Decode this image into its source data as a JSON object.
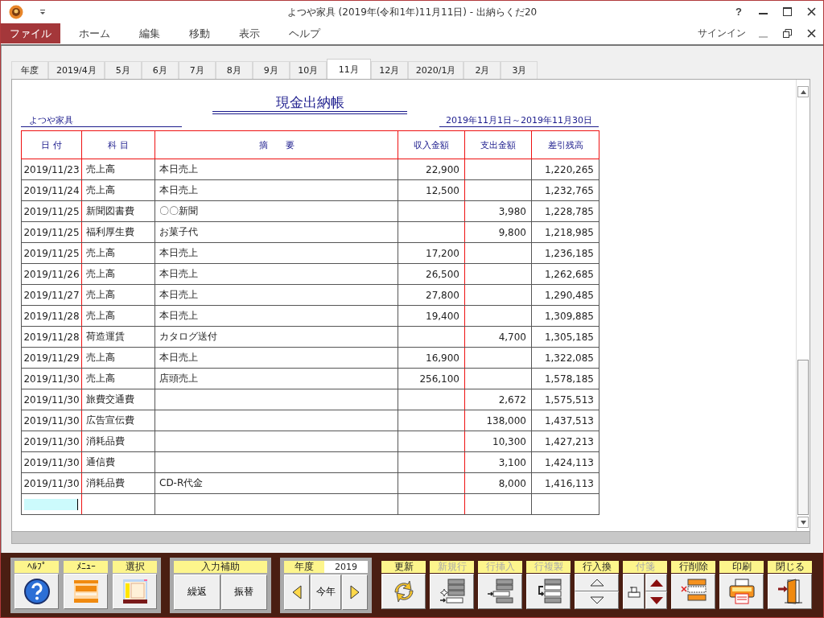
{
  "window": {
    "title": "よつや家具 (2019年(令和1年)11月11日) - 出納らくだ20",
    "help": "?"
  },
  "menu": {
    "items": [
      {
        "label": "ファイル",
        "selected": true
      },
      {
        "label": "ホーム",
        "selected": false
      },
      {
        "label": "編集",
        "selected": false
      },
      {
        "label": "移動",
        "selected": false
      },
      {
        "label": "表示",
        "selected": false
      },
      {
        "label": "ヘルプ",
        "selected": false
      }
    ],
    "signin": "サインイン"
  },
  "tabs": [
    {
      "label": "年度",
      "selected": false
    },
    {
      "label": "2019/4月",
      "selected": false
    },
    {
      "label": "5月",
      "selected": false
    },
    {
      "label": "6月",
      "selected": false
    },
    {
      "label": "7月",
      "selected": false
    },
    {
      "label": "8月",
      "selected": false
    },
    {
      "label": "9月",
      "selected": false
    },
    {
      "label": "10月",
      "selected": false
    },
    {
      "label": "11月",
      "selected": true
    },
    {
      "label": "12月",
      "selected": false
    },
    {
      "label": "2020/1月",
      "selected": false
    },
    {
      "label": "2月",
      "selected": false
    },
    {
      "label": "3月",
      "selected": false
    }
  ],
  "report": {
    "title": "現金出納帳",
    "company": "よつや家具",
    "period": "2019年11月1日～2019年11月30日",
    "columns": [
      "日 付",
      "科 目",
      "摘　　要",
      "収入金額",
      "支出金額",
      "差引残高"
    ],
    "rows": [
      {
        "date": "2019/11/23",
        "account": "売上高",
        "memo": "本日売上",
        "income": "22,900",
        "balance": "1,220,265"
      },
      {
        "date": "2019/11/24",
        "account": "売上高",
        "memo": "本日売上",
        "income": "12,500",
        "balance": "1,232,765"
      },
      {
        "date": "2019/11/25",
        "account": "新聞図書費",
        "memo": "〇〇新聞",
        "expense": "3,980",
        "balance": "1,228,785"
      },
      {
        "date": "2019/11/25",
        "account": "福利厚生費",
        "memo": "お菓子代",
        "expense": "9,800",
        "balance": "1,218,985"
      },
      {
        "date": "2019/11/25",
        "account": "売上高",
        "memo": "本日売上",
        "income": "17,200",
        "balance": "1,236,185"
      },
      {
        "date": "2019/11/26",
        "account": "売上高",
        "memo": "本日売上",
        "income": "26,500",
        "balance": "1,262,685"
      },
      {
        "date": "2019/11/27",
        "account": "売上高",
        "memo": "本日売上",
        "income": "27,800",
        "balance": "1,290,485"
      },
      {
        "date": "2019/11/28",
        "account": "売上高",
        "memo": "本日売上",
        "income": "19,400",
        "balance": "1,309,885"
      },
      {
        "date": "2019/11/28",
        "account": "荷造運賃",
        "memo": "カタログ送付",
        "expense": "4,700",
        "balance": "1,305,185"
      },
      {
        "date": "2019/11/29",
        "account": "売上高",
        "memo": "本日売上",
        "income": "16,900",
        "balance": "1,322,085"
      },
      {
        "date": "2019/11/30",
        "account": "売上高",
        "memo": "店頭売上",
        "income": "256,100",
        "balance": "1,578,185"
      },
      {
        "date": "2019/11/30",
        "account": "旅費交通費",
        "expense": "2,672",
        "balance": "1,575,513"
      },
      {
        "date": "2019/11/30",
        "account": "広告宣伝費",
        "expense": "138,000",
        "balance": "1,437,513"
      },
      {
        "date": "2019/11/30",
        "account": "消耗品費",
        "expense": "10,300",
        "balance": "1,427,213"
      },
      {
        "date": "2019/11/30",
        "account": "通信費",
        "expense": "3,100",
        "balance": "1,424,113"
      },
      {
        "date": "2019/11/30",
        "account": "消耗品費",
        "memo": "CD-R代金",
        "expense": "8,000",
        "balance": "1,416,113"
      }
    ],
    "entry": {
      "active": true
    }
  },
  "toolbar": {
    "panels": [
      {
        "kind": "tools",
        "items": [
          {
            "label": "ﾍﾙﾌﾟ",
            "kind": "help",
            "disabled": false
          },
          {
            "label": "ﾒﾆｭｰ",
            "kind": "menu",
            "disabled": false
          },
          {
            "label": "選択",
            "kind": "select",
            "disabled": false
          }
        ]
      },
      {
        "kind": "assist",
        "label": "入力補助",
        "buttons": [
          "繰返",
          "振替"
        ]
      },
      {
        "kind": "year",
        "label": "年度",
        "value": "2019",
        "button": "今年"
      }
    ],
    "actions": [
      {
        "label": "更新",
        "kind": "refresh",
        "disabled": false
      },
      {
        "label": "新規行",
        "kind": "new_row",
        "disabled": true
      },
      {
        "label": "行挿入",
        "kind": "insert_row",
        "disabled": true
      },
      {
        "label": "行複製",
        "kind": "copy_row",
        "disabled": true
      },
      {
        "label": "行入換",
        "kind": "swap",
        "disabled": false
      },
      {
        "label": "付箋",
        "kind": "sticky",
        "disabled": true
      },
      {
        "label": "行削除",
        "kind": "delete_row",
        "disabled": false
      },
      {
        "label": "印刷",
        "kind": "print",
        "disabled": false
      },
      {
        "label": "閉じる",
        "kind": "close",
        "disabled": false
      }
    ]
  }
}
